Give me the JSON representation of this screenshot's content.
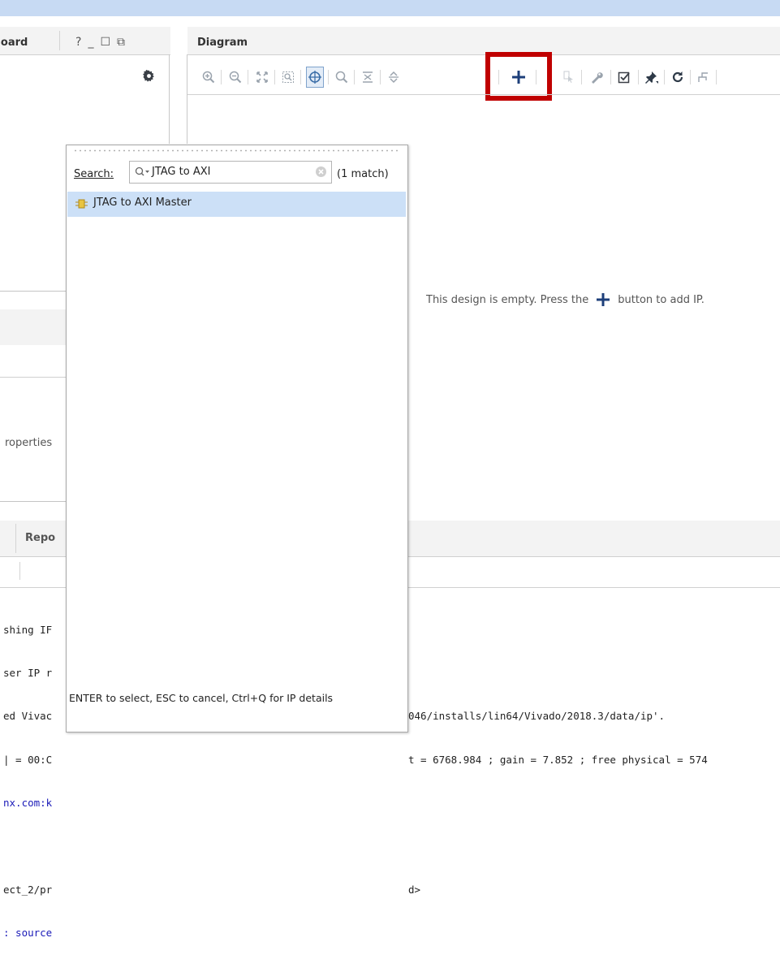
{
  "left_panel": {
    "header_title": "Board",
    "header_controls": [
      "?",
      "_",
      "☐",
      "⧉"
    ],
    "properties_label": "roperties",
    "bottom_tab": "Repo"
  },
  "diagram": {
    "title": "Diagram",
    "empty_message_before": "This design is empty. Press the",
    "empty_message_after": "button to add IP."
  },
  "toolbar": {
    "icons": [
      "zoom-in-icon",
      "zoom-out-icon",
      "fit-icon",
      "zoom-area-icon",
      "select-icon",
      "search-icon",
      "collapse-icon",
      "expand-icon",
      "add-ip-icon",
      "pointer-icon",
      "wrench-icon",
      "validate-icon",
      "pin-icon",
      "refresh-icon",
      "optimize-icon"
    ],
    "highlight_color": "#c00000"
  },
  "console": {
    "lines_left": [
      "shing IF",
      "ser IP r",
      "ed Vivac",
      "| = 00:C",
      "nx.com:k",
      "",
      "ect_2/pr",
      ": source"
    ],
    "lines_right": [
      "",
      "",
      "046/installs/lin64/Vivado/2018.3/data/ip'.",
      "t = 6768.984 ; gain = 7.852 ; free physical = 574",
      "",
      "",
      "d>",
      ""
    ]
  },
  "ip_popup": {
    "search_label": "Search:",
    "search_value": "JTAG to AXI",
    "match_count": "(1 match)",
    "results": [
      {
        "label": "JTAG to AXI Master",
        "selected": true
      }
    ],
    "footer": "ENTER to select, ESC to cancel, Ctrl+Q for IP details"
  }
}
